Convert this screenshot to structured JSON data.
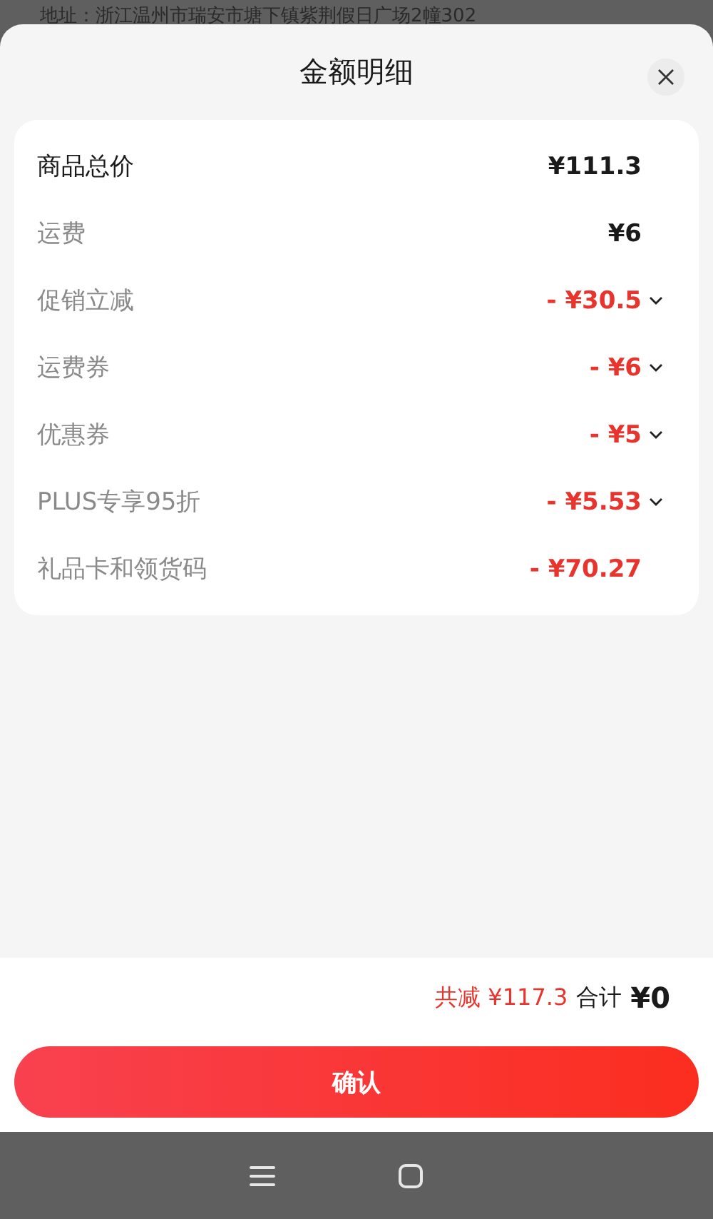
{
  "background_text": "地址：浙江温州市瑞安市塘下镇紫荆假日广场2幢302",
  "title": "金额明细",
  "rows": [
    {
      "label": "商品总价",
      "amount": "¥111.3",
      "kind": "total",
      "expandable": false
    },
    {
      "label": "运费",
      "amount": "¥6",
      "kind": "fee",
      "expandable": false
    },
    {
      "label": "促销立减",
      "amount": "- ¥30.5",
      "kind": "discount",
      "expandable": true
    },
    {
      "label": "运费券",
      "amount": "- ¥6",
      "kind": "discount",
      "expandable": true
    },
    {
      "label": "优惠券",
      "amount": "- ¥5",
      "kind": "discount",
      "expandable": true
    },
    {
      "label": "PLUS专享95折",
      "amount": "- ¥5.53",
      "kind": "discount",
      "expandable": true
    },
    {
      "label": "礼品卡和领货码",
      "amount": "- ¥70.27",
      "kind": "discount",
      "expandable": false
    }
  ],
  "summary": {
    "saved": "共减 ¥117.3",
    "total_label": "合计",
    "total": "¥0"
  },
  "confirm_button": "确认"
}
